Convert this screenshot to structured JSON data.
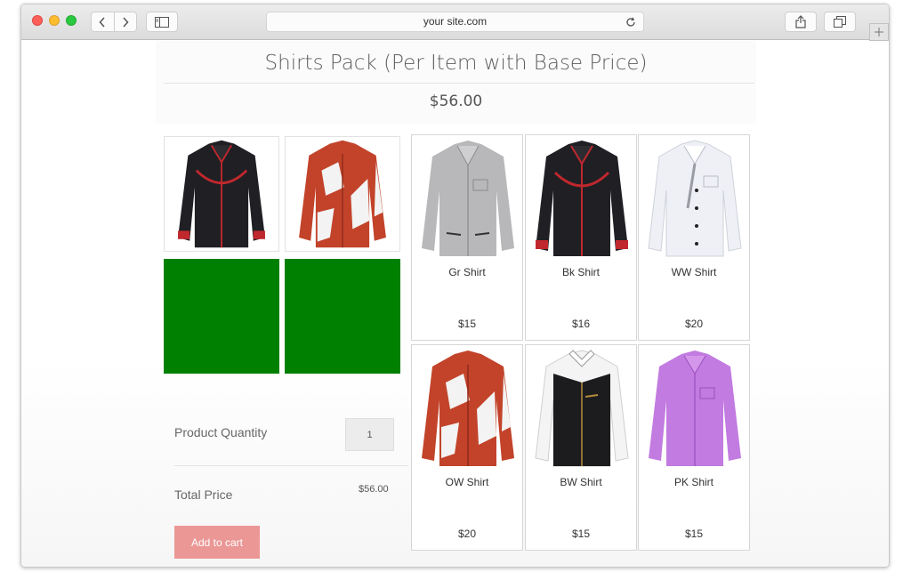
{
  "browser": {
    "address": "your site.com"
  },
  "page": {
    "title": "Shirts Pack (Per Item with Base Price)",
    "price": "$56.00"
  },
  "selected_items": [
    {
      "shirt": "black-red-shirt"
    },
    {
      "shirt": "orange-white-shirt"
    }
  ],
  "colors": {
    "empty_slot": "#008000",
    "add_to_cart": "#eb9795",
    "title": "#5e5e5e"
  },
  "form": {
    "quantity_label": "Product Quantity",
    "quantity_value": "1",
    "total_label": "Total Price",
    "total_value": "$56.00",
    "add_to_cart_label": "Add to cart"
  },
  "products": [
    {
      "name": "Gr Shirt",
      "price": "$15",
      "shirt": "grey-shirt"
    },
    {
      "name": "Bk Shirt",
      "price": "$16",
      "shirt": "black-red-shirt"
    },
    {
      "name": "WW Shirt",
      "price": "$20",
      "shirt": "white-shirt"
    },
    {
      "name": "OW Shirt",
      "price": "$20",
      "shirt": "orange-white-shirt"
    },
    {
      "name": "BW Shirt",
      "price": "$15",
      "shirt": "black-white-shirt"
    },
    {
      "name": "PK Shirt",
      "price": "$15",
      "shirt": "purple-shirt"
    }
  ]
}
